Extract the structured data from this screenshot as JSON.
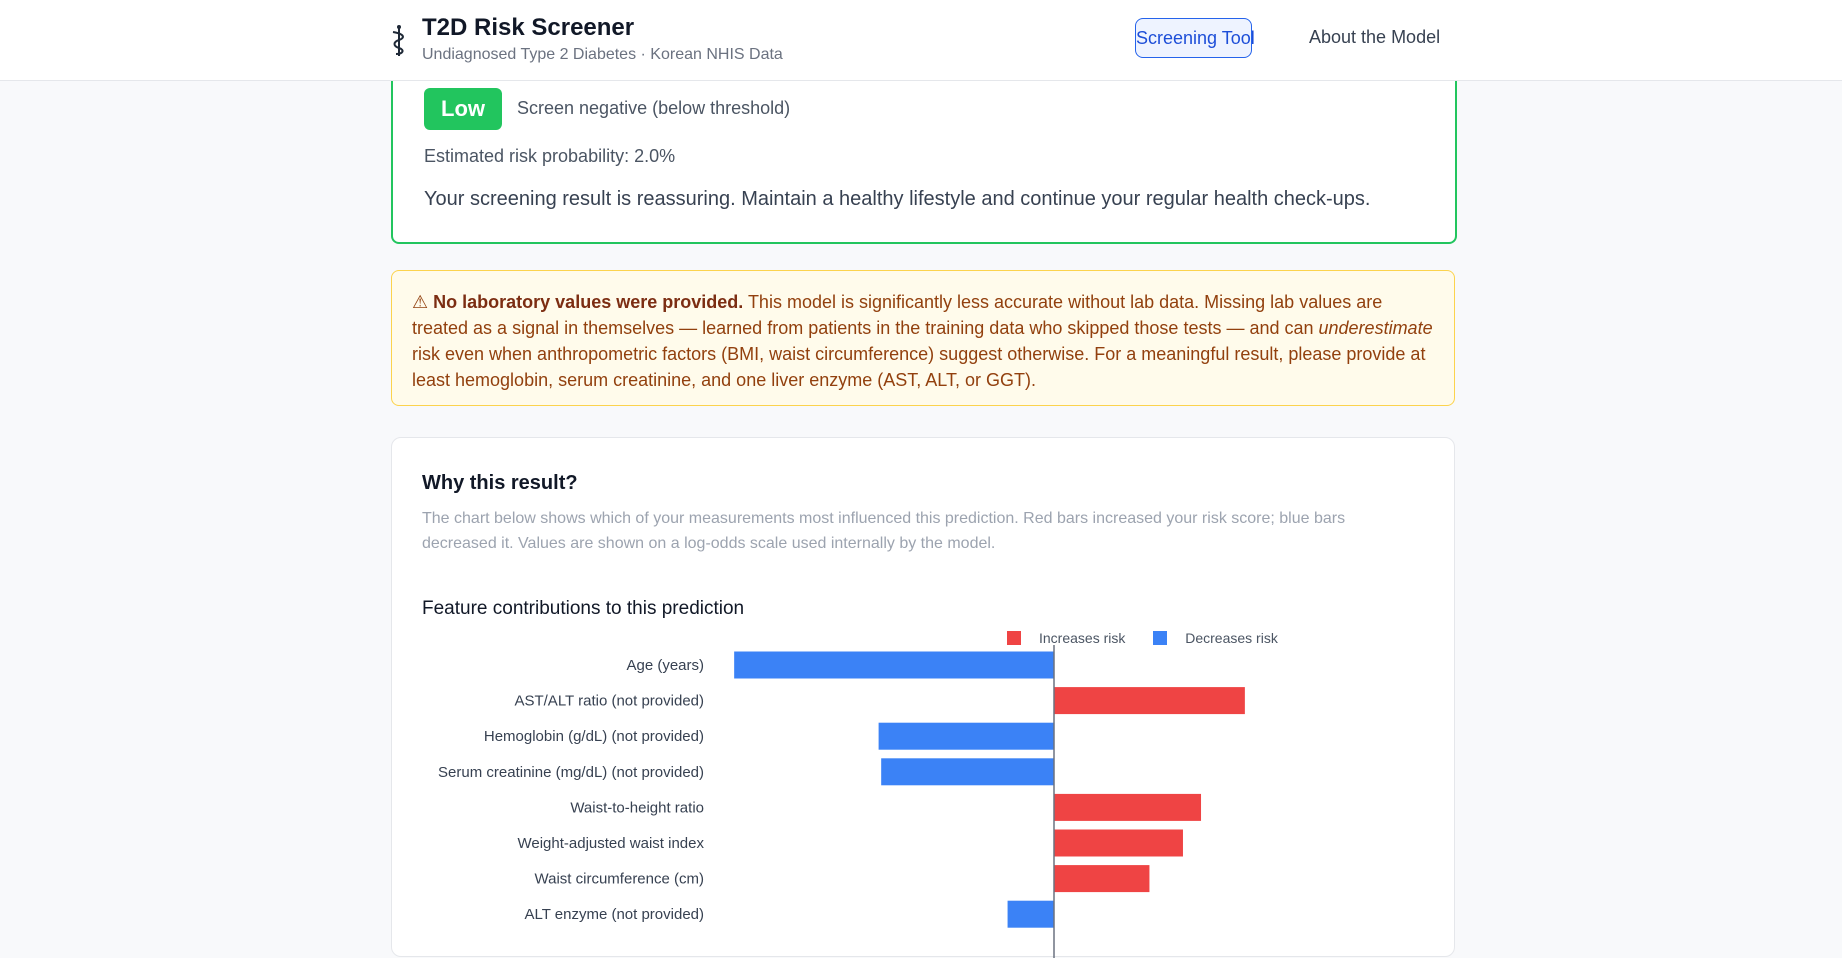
{
  "header": {
    "title": "T2D Risk Screener",
    "subtitle": "Undiagnosed Type 2 Diabetes · Korean NHIS Data",
    "nav": {
      "screening": "Screening Tool",
      "about": "About the Model"
    }
  },
  "result": {
    "level": "Low",
    "status": "Screen negative (below threshold)",
    "probability": "Estimated risk probability: 2.0%",
    "message": "Your screening result is reassuring. Maintain a healthy lifestyle and continue your regular health check-ups."
  },
  "warning": {
    "icon": "⚠",
    "bold": "No laboratory values were provided.",
    "part1": " This model is significantly less accurate without lab data. Missing lab values are treated as a signal in themselves — learned from patients in the training data who skipped those tests — and can ",
    "emph": "underestimate",
    "part2": " risk even when anthropometric factors (BMI, waist circumference) suggest otherwise. For a meaningful result, please provide at least hemoglobin, serum creatinine, and one liver enzyme (AST, ALT, or GGT)."
  },
  "why": {
    "title": "Why this result?",
    "description": "The chart below shows which of your measurements most influenced this prediction. Red bars increased your risk score; blue bars decreased it. Values are shown on a log-odds scale used internally by the model."
  },
  "colors": {
    "increase": "#ef4444",
    "decrease": "#3b82f6",
    "success": "#22c55e"
  },
  "chart_data": {
    "type": "bar",
    "orientation": "horizontal",
    "title": "Feature contributions to this prediction",
    "legend": [
      "Increases risk",
      "Decreases risk"
    ],
    "legend_position": "top-right",
    "categories": [
      "Age (years)",
      "AST/ALT ratio (not provided)",
      "Hemoglobin (g/dL) (not provided)",
      "Serum creatinine (mg/dL) (not provided)",
      "Waist-to-height ratio",
      "Weight-adjusted waist index",
      "Waist circumference (cm)",
      "ALT enzyme (not provided)"
    ],
    "values": [
      -0.62,
      0.37,
      -0.34,
      -0.335,
      0.285,
      0.25,
      0.185,
      -0.09
    ],
    "xlim": [
      -0.63,
      0.63
    ],
    "grid": false
  }
}
